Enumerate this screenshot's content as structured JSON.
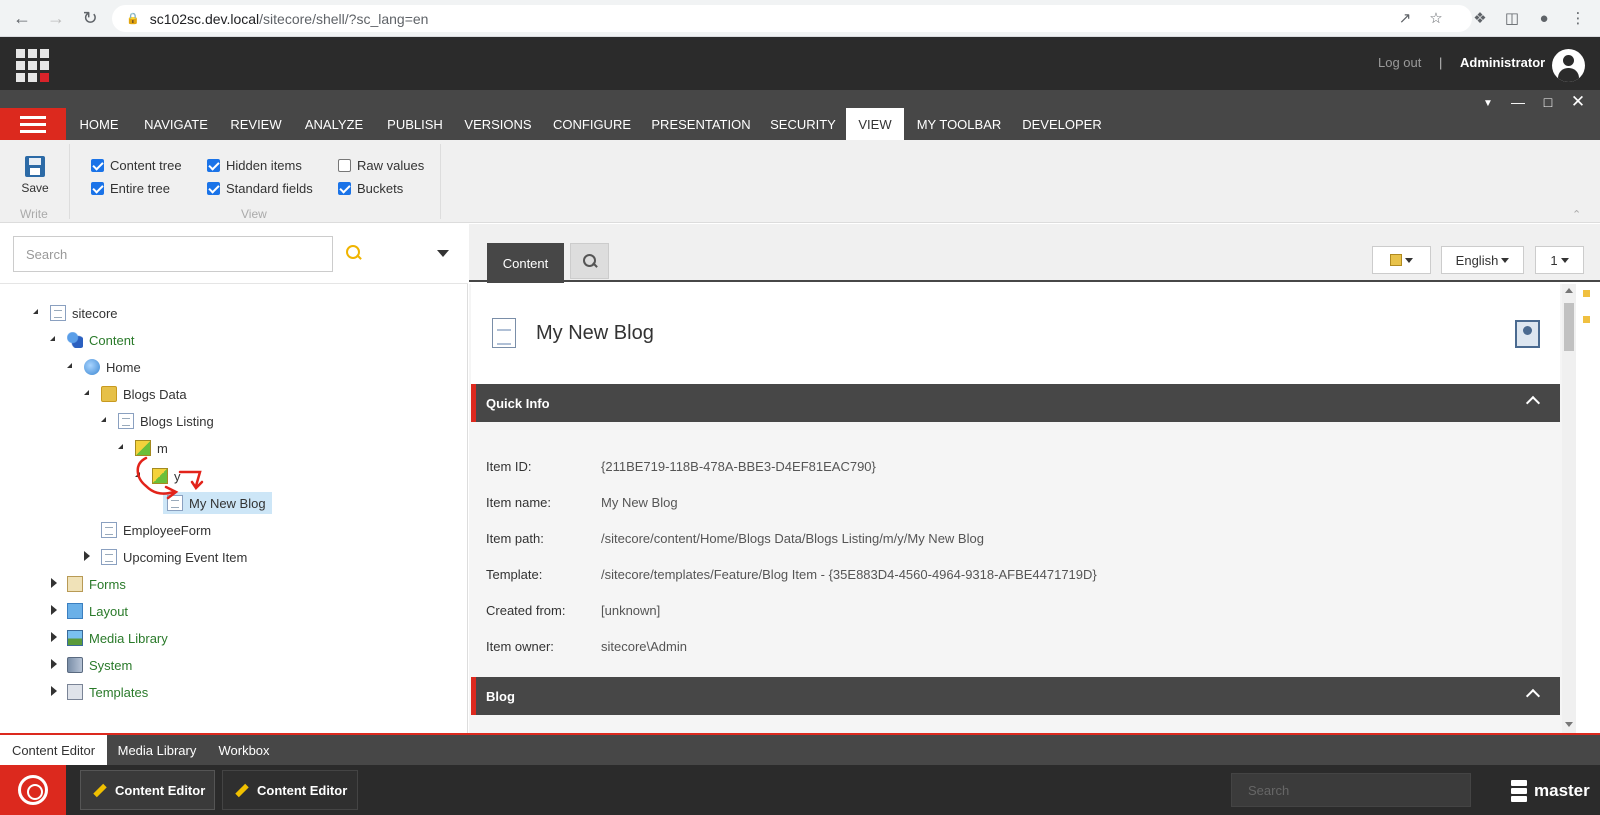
{
  "browser": {
    "url_host": "sc102sc.dev.local",
    "url_path": "/sitecore/shell/?sc_lang=en"
  },
  "header": {
    "logout": "Log out",
    "separator": "|",
    "user": "Administrator"
  },
  "ribbon": {
    "tabs": [
      "HOME",
      "NAVIGATE",
      "REVIEW",
      "ANALYZE",
      "PUBLISH",
      "VERSIONS",
      "CONFIGURE",
      "PRESENTATION",
      "SECURITY",
      "VIEW",
      "MY TOOLBAR",
      "DEVELOPER"
    ],
    "active_tab": "VIEW",
    "save_label": "Save",
    "write_group": "Write",
    "view_group": "View",
    "checkboxes": [
      {
        "label": "Content tree",
        "checked": true
      },
      {
        "label": "Entire tree",
        "checked": true
      },
      {
        "label": "Hidden items",
        "checked": true
      },
      {
        "label": "Standard fields",
        "checked": true
      },
      {
        "label": "Raw values",
        "checked": false
      },
      {
        "label": "Buckets",
        "checked": true
      }
    ]
  },
  "tree": {
    "search_placeholder": "Search",
    "nodes": [
      {
        "label": "sitecore",
        "icon": "document-icon"
      },
      {
        "label": "Content",
        "icon": "content-icon"
      },
      {
        "label": "Home",
        "icon": "globe-icon"
      },
      {
        "label": "Blogs Data",
        "icon": "folder-icon"
      },
      {
        "label": "Blogs Listing",
        "icon": "document-icon"
      },
      {
        "label": "m",
        "icon": "bucket-icon"
      },
      {
        "label": "y",
        "icon": "bucket-icon"
      },
      {
        "label": "My New Blog",
        "icon": "document-icon"
      },
      {
        "label": "EmployeeForm",
        "icon": "document-icon"
      },
      {
        "label": "Upcoming Event Item",
        "icon": "document-icon"
      },
      {
        "label": "Forms",
        "icon": "forms-icon"
      },
      {
        "label": "Layout",
        "icon": "layout-icon"
      },
      {
        "label": "Media Library",
        "icon": "media-icon"
      },
      {
        "label": "System",
        "icon": "system-icon"
      },
      {
        "label": "Templates",
        "icon": "templates-icon"
      }
    ]
  },
  "editor": {
    "content_tab": "Content",
    "language": "English",
    "version": "1",
    "item_title": "My New Blog",
    "sections": {
      "quick_info": "Quick Info",
      "blog": "Blog"
    },
    "quick_info": [
      {
        "label": "Item ID:",
        "value": "{211BE719-118B-478A-BBE3-D4EF81EAC790}"
      },
      {
        "label": "Item name:",
        "value": "My New Blog"
      },
      {
        "label": "Item path:",
        "value": "/sitecore/content/Home/Blogs Data/Blogs Listing/m/y/My New Blog"
      },
      {
        "label": "Template:",
        "value": "/sitecore/templates/Feature/Blog Item - {35E883D4-4560-4964-9318-AFBE4471719D}"
      },
      {
        "label": "Created from:",
        "value": "[unknown]"
      },
      {
        "label": "Item owner:",
        "value": "sitecore\\Admin"
      }
    ]
  },
  "bottom_tabs": [
    "Content Editor",
    "Media Library",
    "Workbox"
  ],
  "taskbar": {
    "buttons": [
      "Content Editor",
      "Content Editor"
    ],
    "search_placeholder": "Search",
    "database": "master"
  },
  "colors": {
    "accent_red": "#dc291e",
    "dark_bar": "#2b2b2b",
    "ribbon_tabs": "#474747",
    "tree_green": "#2a7a2a"
  }
}
